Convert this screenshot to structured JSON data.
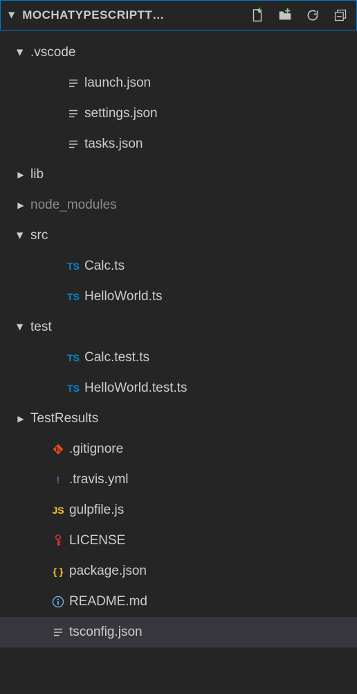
{
  "header": {
    "title": "MOCHATYPESCRIPTT…"
  },
  "tree": [
    {
      "id": "vscode",
      "label": ".vscode",
      "kind": "folder",
      "expanded": true,
      "indent": 0
    },
    {
      "id": "launch",
      "label": "launch.json",
      "kind": "file",
      "icon": "generic",
      "indent": 1
    },
    {
      "id": "settings",
      "label": "settings.json",
      "kind": "file",
      "icon": "generic",
      "indent": 1
    },
    {
      "id": "tasks",
      "label": "tasks.json",
      "kind": "file",
      "icon": "generic",
      "indent": 1
    },
    {
      "id": "lib",
      "label": "lib",
      "kind": "folder",
      "expanded": false,
      "indent": 0
    },
    {
      "id": "node_modules",
      "label": "node_modules",
      "kind": "folder",
      "expanded": false,
      "indent": 0,
      "dim": true
    },
    {
      "id": "src",
      "label": "src",
      "kind": "folder",
      "expanded": true,
      "indent": 0
    },
    {
      "id": "calc",
      "label": "Calc.ts",
      "kind": "file",
      "icon": "ts",
      "indent": 1
    },
    {
      "id": "helloworld",
      "label": "HelloWorld.ts",
      "kind": "file",
      "icon": "ts",
      "indent": 1
    },
    {
      "id": "test",
      "label": "test",
      "kind": "folder",
      "expanded": true,
      "indent": 0
    },
    {
      "id": "calc-test",
      "label": "Calc.test.ts",
      "kind": "file",
      "icon": "ts",
      "indent": 1
    },
    {
      "id": "helloworld-test",
      "label": "HelloWorld.test.ts",
      "kind": "file",
      "icon": "ts",
      "indent": 1
    },
    {
      "id": "testresults",
      "label": "TestResults",
      "kind": "folder",
      "expanded": false,
      "indent": 0
    },
    {
      "id": "gitignore",
      "label": ".gitignore",
      "kind": "file",
      "icon": "git",
      "indent": 0
    },
    {
      "id": "travis",
      "label": ".travis.yml",
      "kind": "file",
      "icon": "yml",
      "indent": 0
    },
    {
      "id": "gulpfile",
      "label": "gulpfile.js",
      "kind": "file",
      "icon": "js",
      "indent": 0
    },
    {
      "id": "license",
      "label": "LICENSE",
      "kind": "file",
      "icon": "key",
      "indent": 0
    },
    {
      "id": "package",
      "label": "package.json",
      "kind": "file",
      "icon": "json",
      "indent": 0
    },
    {
      "id": "readme",
      "label": "README.md",
      "kind": "file",
      "icon": "info",
      "indent": 0
    },
    {
      "id": "tsconfig",
      "label": "tsconfig.json",
      "kind": "file",
      "icon": "generic",
      "indent": 0,
      "selected": true
    }
  ]
}
